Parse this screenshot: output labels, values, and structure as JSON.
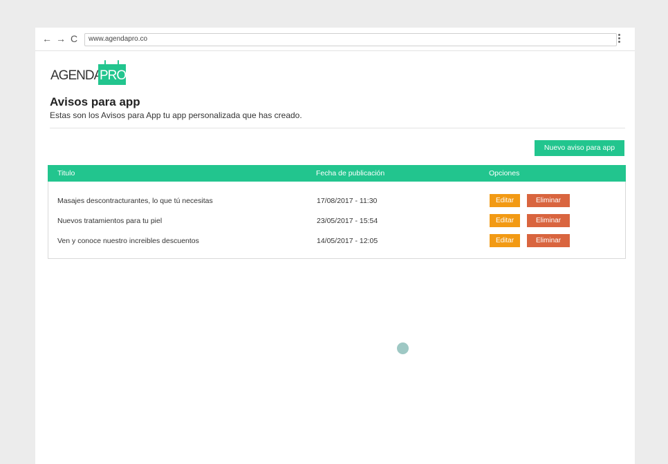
{
  "browser": {
    "back_icon": "←",
    "forward_icon": "→",
    "reload_icon": "C",
    "url": "www.agendapro.co"
  },
  "logo": {
    "part1": "AGENDA",
    "part2": "PRO"
  },
  "page": {
    "title": "Avisos para app",
    "subtitle": "Estas son los Avisos para App tu app personalizada que has creado.",
    "new_button": "Nuevo aviso para app"
  },
  "table": {
    "headers": [
      "Titulo",
      "Fecha de publicación",
      "Opciones"
    ],
    "rows": [
      {
        "title": "Masajes descontracturantes, lo que tú necesitas",
        "date": "17/08/2017 - 11:30",
        "edit": "Editar",
        "delete": "Eliminar"
      },
      {
        "title": "Nuevos tratamientos para tu piel",
        "date": "23/05/2017 - 15:54",
        "edit": "Editar",
        "delete": "Eliminar"
      },
      {
        "title": "Ven y conoce nuestro increibles descuentos",
        "date": "14/05/2017 - 12:05",
        "edit": "Editar",
        "delete": "Eliminar"
      }
    ]
  },
  "colors": {
    "brand_green": "#22c58e",
    "edit_orange": "#f29a14",
    "delete_red": "#d9653f"
  }
}
